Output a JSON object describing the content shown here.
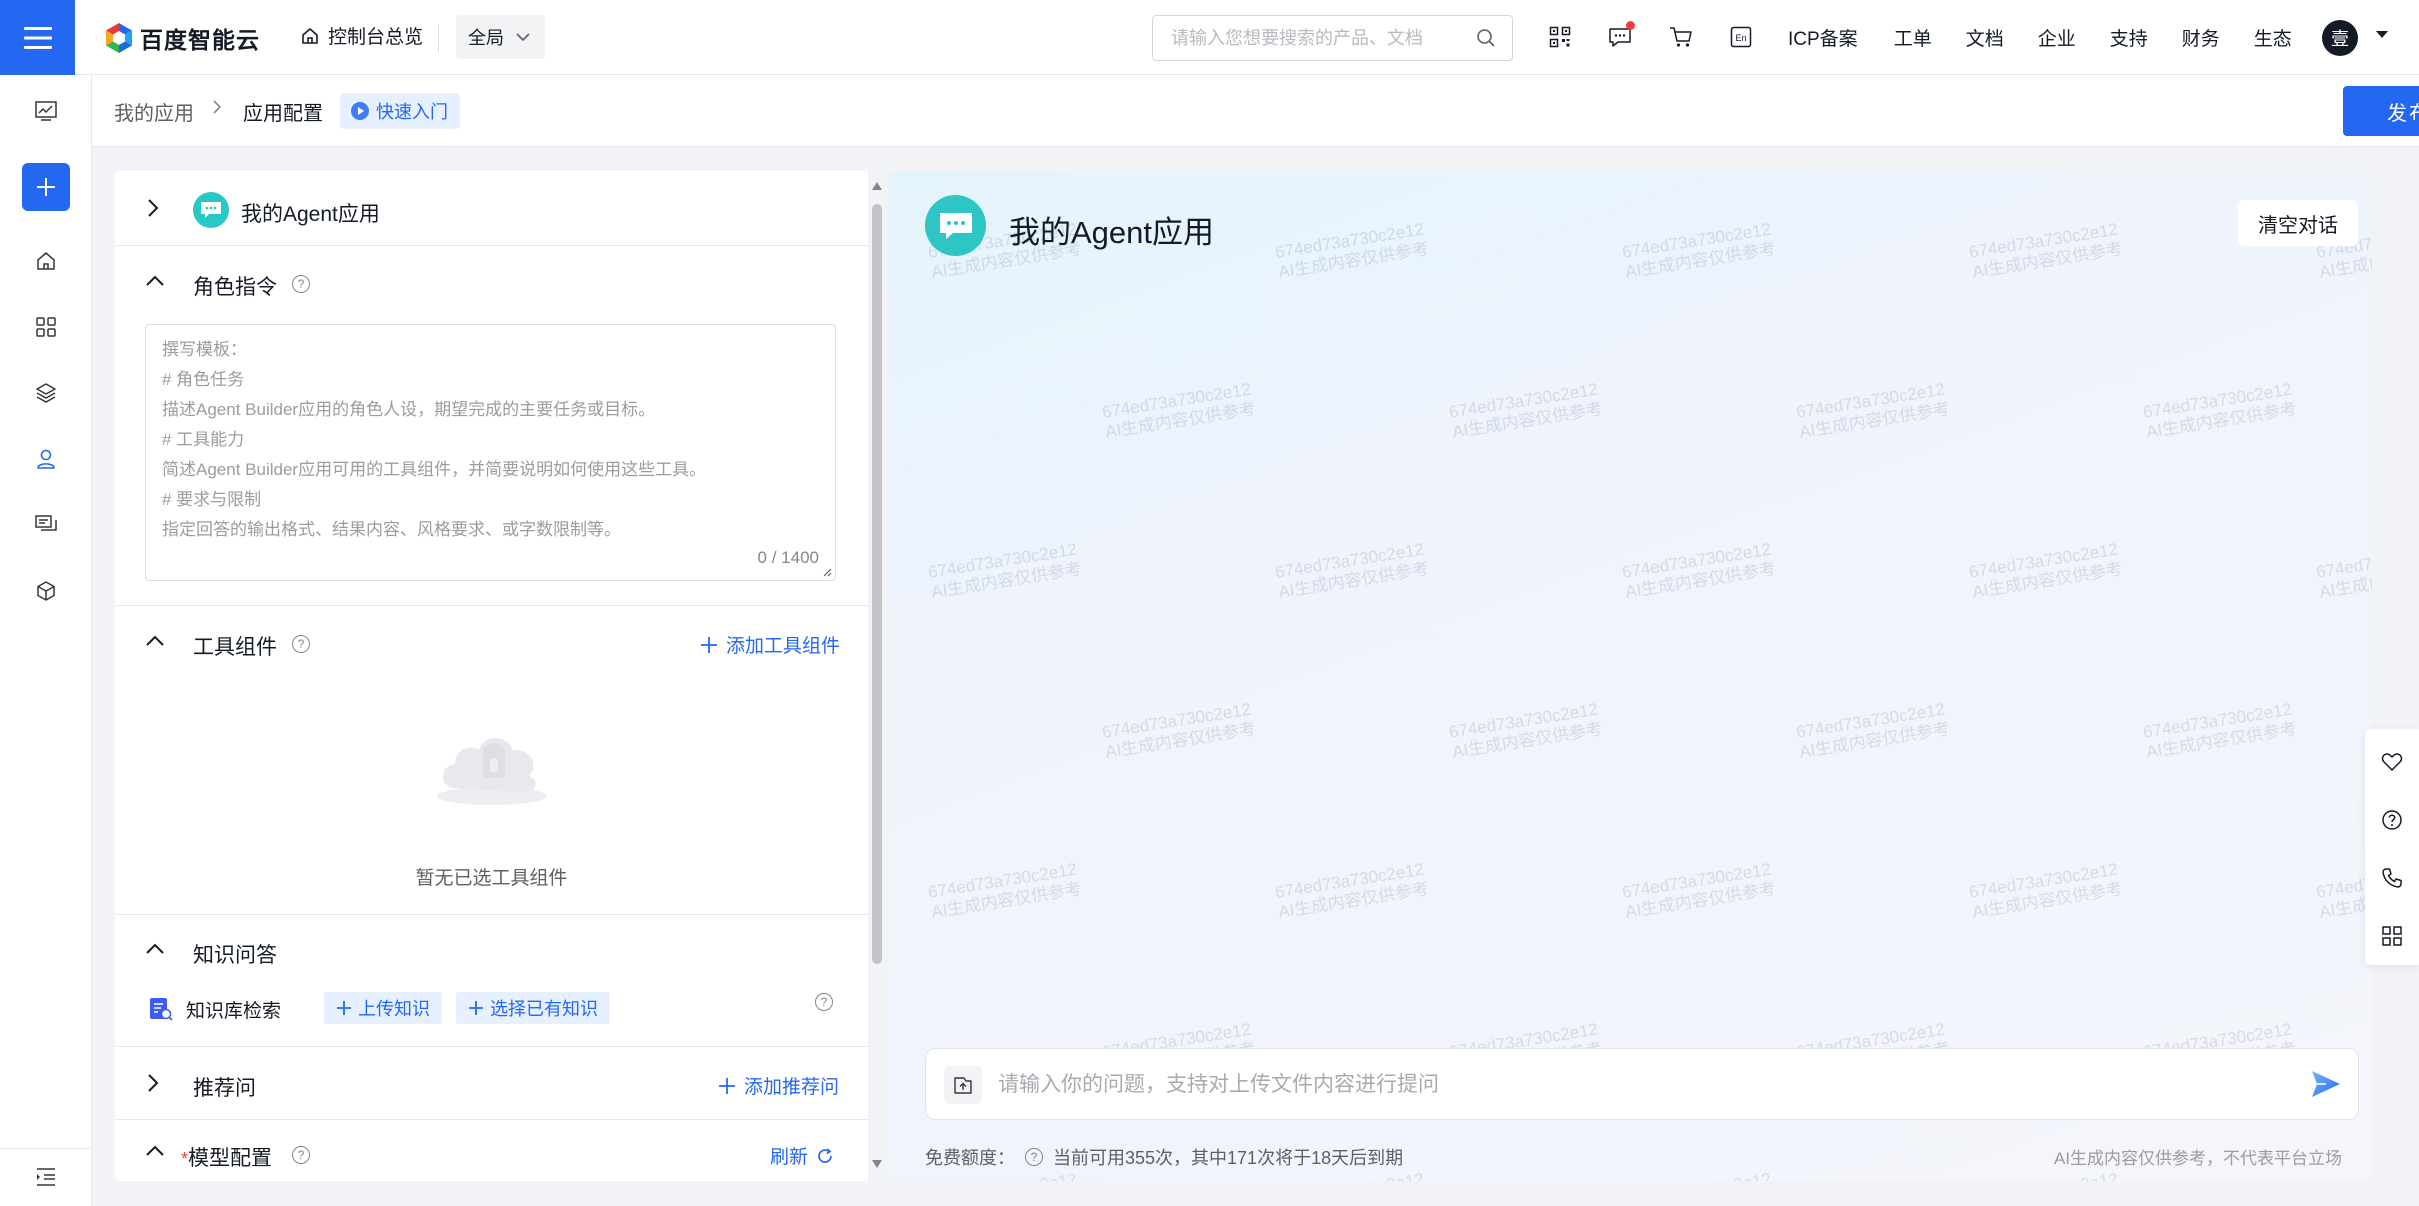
{
  "header": {
    "logo_text": "百度智能云",
    "console_label": "控制台总览",
    "region_label": "全局",
    "search_placeholder": "请输入您想要搜索的产品、文档",
    "nav_links": [
      "ICP备案",
      "工单",
      "文档",
      "企业",
      "支持",
      "财务",
      "生态"
    ],
    "avatar_text": "壹"
  },
  "breadcrumb": {
    "items": [
      "我的应用",
      "应用配置"
    ],
    "quick_start": "快速入门",
    "publish_label": "发布"
  },
  "config": {
    "app_name": "我的Agent应用",
    "role": {
      "title": "角色指令",
      "placeholder_lines": [
        "撰写模板：",
        "# 角色任务",
        "描述Agent Builder应用的角色人设，期望完成的主要任务或目标。",
        "# 工具能力",
        "简述Agent Builder应用可用的工具组件，并简要说明如何使用这些工具。",
        "# 要求与限制",
        "指定回答的输出格式、结果内容、风格要求、或字数限制等。"
      ],
      "counter": "0 / 1400"
    },
    "tools": {
      "title": "工具组件",
      "add_label": "添加工具组件",
      "empty_text": "暂无已选工具组件"
    },
    "knowledge": {
      "title": "知识问答",
      "row_label": "知识库检索",
      "upload_label": "上传知识",
      "select_label": "选择已有知识"
    },
    "recommend": {
      "title": "推荐问",
      "add_label": "添加推荐问"
    },
    "model": {
      "required_mark": "*",
      "title": "模型配置",
      "refresh_label": "刷新"
    }
  },
  "preview": {
    "title": "我的Agent应用",
    "clear_label": "清空对话",
    "watermark_line1": "674ed73a730c2e12",
    "watermark_line2": "AI生成内容仅供参考",
    "input_placeholder": "请输入你的问题，支持对上传文件内容进行提问",
    "quota_label": "免费额度：",
    "quota_text": "当前可用355次，其中171次将于18天后到期",
    "disclaimer": "AI生成内容仅供参考，不代表平台立场"
  },
  "colors": {
    "primary": "#2468f2",
    "accent_teal": "#2ec5c5",
    "required": "#f33e3e"
  }
}
